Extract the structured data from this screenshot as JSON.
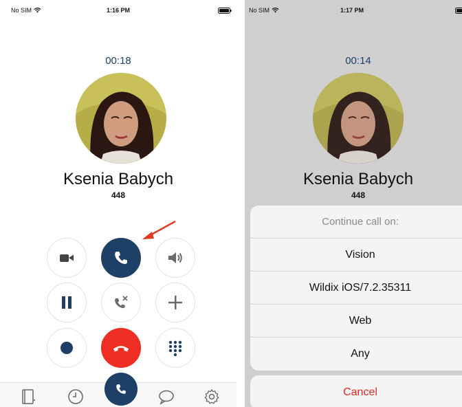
{
  "left_screen": {
    "status": {
      "carrier": "No SIM",
      "time": "1:16 PM"
    },
    "call": {
      "timer": "00:18",
      "contact_name": "Ksenia Babych",
      "extension": "448"
    },
    "controls": [
      {
        "icon": "video-camera-icon",
        "state": "normal"
      },
      {
        "icon": "phone-icon",
        "state": "active"
      },
      {
        "icon": "speaker-icon",
        "state": "normal"
      },
      {
        "icon": "pause-icon",
        "state": "normal"
      },
      {
        "icon": "call-transfer-icon",
        "state": "normal"
      },
      {
        "icon": "plus-icon",
        "state": "normal"
      },
      {
        "icon": "record-icon",
        "state": "normal"
      },
      {
        "icon": "end-call-icon",
        "state": "end"
      },
      {
        "icon": "keypad-icon",
        "state": "normal"
      }
    ],
    "tab_bar": [
      "phonebook-icon",
      "history-clock-icon",
      "phone-icon",
      "chat-bubble-icon",
      "settings-gear-icon"
    ]
  },
  "right_screen": {
    "status": {
      "carrier": "No SIM",
      "time": "1:17 PM"
    },
    "call": {
      "timer": "00:14",
      "contact_name": "Ksenia Babych",
      "extension": "448"
    },
    "action_sheet": {
      "title": "Continue call on:",
      "options": [
        "Vision",
        "Wildix iOS/7.2.35311",
        "Web",
        "Any"
      ],
      "cancel_label": "Cancel"
    }
  },
  "colors": {
    "primary_navy": "#1e3f66",
    "end_call_red": "#ee2e24",
    "cancel_red": "#e0281f",
    "annotation_arrow": "#e03a22",
    "dim_overlay": "#cfcfcf"
  }
}
